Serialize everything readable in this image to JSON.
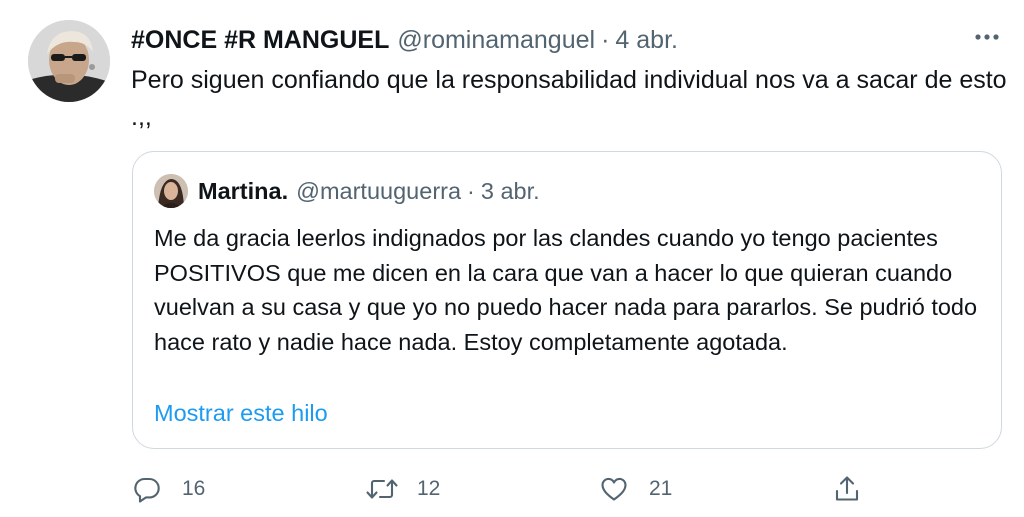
{
  "tweet": {
    "author": {
      "display_name": "#ONCE #R MANGUEL",
      "handle": "@rominamanguel",
      "separator": "·",
      "date": "4 abr."
    },
    "text": "Pero siguen confiando que la responsabilidad individual nos va a sacar de esto .,,",
    "more_icon": "more-horizontal-icon",
    "quote": {
      "author": {
        "display_name": "Martina.",
        "handle": "@martuuguerra",
        "separator": "·",
        "date": "3 abr."
      },
      "text": "Me da gracia leerlos indignados por las clandes cuando yo tengo pacientes POSITIVOS que me dicen en la cara que van a hacer lo que quieran cuando vuelvan a su casa y que yo no puedo hacer nada para pararlos. Se pudrió todo hace rato y nadie hace nada. Estoy completamente agotada.",
      "show_thread_label": "Mostrar este hilo"
    },
    "actions": {
      "reply": {
        "icon": "reply-icon",
        "count": "16"
      },
      "retweet": {
        "icon": "retweet-icon",
        "count": "12"
      },
      "like": {
        "icon": "heart-icon",
        "count": "21"
      },
      "share": {
        "icon": "share-icon"
      }
    }
  },
  "colors": {
    "text_primary": "#0f1419",
    "text_secondary": "#536471",
    "link": "#1d9bf0",
    "border": "#cfd9de",
    "background": "#ffffff"
  }
}
